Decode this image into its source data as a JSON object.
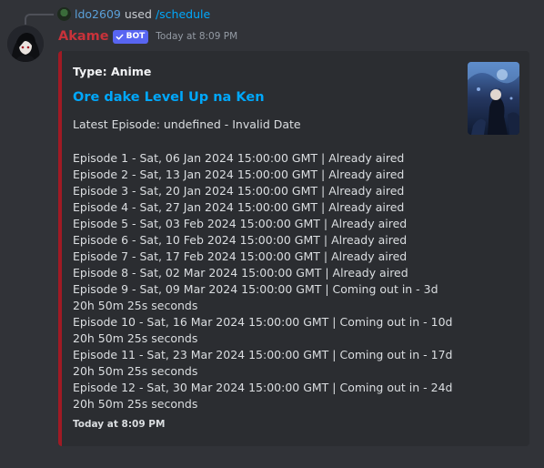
{
  "reply": {
    "user": "ldo2609",
    "used_text": "used",
    "command": "/schedule"
  },
  "message": {
    "author": "Akame",
    "badge": "BOT",
    "timestamp": "Today at 8:09 PM"
  },
  "embed": {
    "type_label": "Type: Anime",
    "title": "Ore dake Level Up na Ken",
    "latest_episode": "Latest Episode: undefined - Invalid Date",
    "episodes": [
      "Episode 1 - Sat, 06 Jan 2024 15:00:00 GMT | Already aired",
      "Episode 2 - Sat, 13 Jan 2024 15:00:00 GMT | Already aired",
      "Episode 3 - Sat, 20 Jan 2024 15:00:00 GMT | Already aired",
      "Episode 4 - Sat, 27 Jan 2024 15:00:00 GMT | Already aired",
      "Episode 5 - Sat, 03 Feb 2024 15:00:00 GMT | Already aired",
      "Episode 6 - Sat, 10 Feb 2024 15:00:00 GMT | Already aired",
      "Episode 7 - Sat, 17 Feb 2024 15:00:00 GMT | Already aired",
      "Episode 8 - Sat, 02 Mar 2024 15:00:00 GMT | Already aired",
      "Episode 9 - Sat, 09 Mar 2024 15:00:00 GMT | Coming out in - 3d 20h 50m 25s seconds",
      "Episode 10 - Sat, 16 Mar 2024 15:00:00 GMT | Coming out in - 10d 20h 50m 25s seconds",
      "Episode 11 - Sat, 23 Mar 2024 15:00:00 GMT | Coming out in - 17d 20h 50m 25s seconds",
      "Episode 12 - Sat, 30 Mar 2024 15:00:00 GMT | Coming out in - 24d 20h 50m 25s seconds"
    ],
    "footer_timestamp": "Today at 8:09 PM",
    "accent_color": "#a01a24"
  },
  "colors": {
    "background": "#313338",
    "embed_background": "#2b2d31",
    "username": "#c8323a",
    "link": "#00a8fc",
    "bot_badge": "#5865f2"
  },
  "icons": {
    "badge_icon": "verified-check-icon"
  }
}
